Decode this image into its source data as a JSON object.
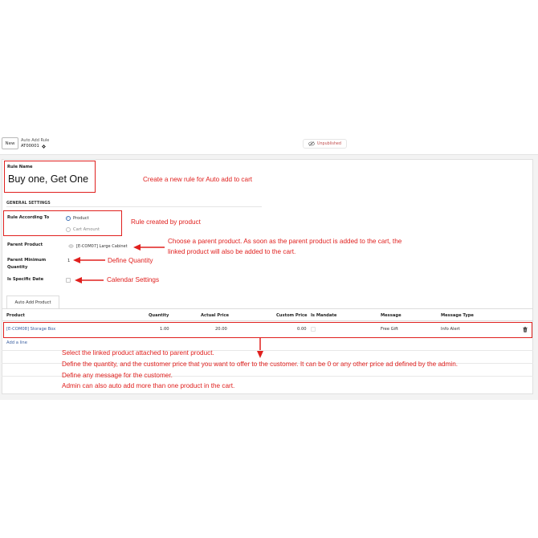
{
  "control_panel": {
    "new_button": "New",
    "breadcrumb_parent": "Auto Add Rule",
    "breadcrumb_current": "AT00001",
    "status_label": "Unpublished"
  },
  "form": {
    "rule_name_label": "Rule Name",
    "rule_name_value": "Buy one, Get One",
    "section_title": "GENERAL SETTINGS",
    "rule_according_label": "Rule According To",
    "rule_options": [
      "Product",
      "Cart Amount"
    ],
    "rule_selected": "Product",
    "parent_product_label": "Parent Product",
    "parent_product_value": "[E-COM07] Large Cabinet",
    "parent_min_qty_label_1": "Parent Minimum",
    "parent_min_qty_label_2": "Quantity",
    "parent_min_qty_value": "1",
    "specific_date_label": "Is Specific Date",
    "specific_date_checked": false
  },
  "tab": {
    "label": "Auto Add Product"
  },
  "table": {
    "headers": [
      "Product",
      "Quantity",
      "Actual Price",
      "Custom Price",
      "Is Mandate",
      "Message",
      "Message Type"
    ],
    "rows": [
      {
        "product": "[E-COM08] Storage Box",
        "quantity": "1.00",
        "actual_price": "20.00",
        "custom_price": "0.00",
        "is_mandate": false,
        "message": "Free Gift",
        "message_type": "Info Alert"
      }
    ],
    "add_line": "Add a line"
  },
  "annotations": {
    "create_rule": "Create a new rule for Auto add to cart",
    "rule_by_product": "Rule created by product",
    "parent_product_1": "Choose a parent product. As soon as the parent product is added to the cart, the",
    "parent_product_2": "linked product will also be added to the cart.",
    "define_quantity": "Define Quantity",
    "calendar": "Calendar Settings",
    "bottom_1": "Select the linked product attached to parent product.",
    "bottom_2": "Define the quantity, and the customer price that you want to offer to the customer. It can be 0 or any other price ad defined by the admin.",
    "bottom_3": "Define any message for the customer.",
    "bottom_4": "Admin can also auto add more than one product in the cart."
  },
  "colors": {
    "annotation_red": "#e0201e",
    "link_blue": "#3a5fa0",
    "radio_blue": "#3c6fb5"
  }
}
